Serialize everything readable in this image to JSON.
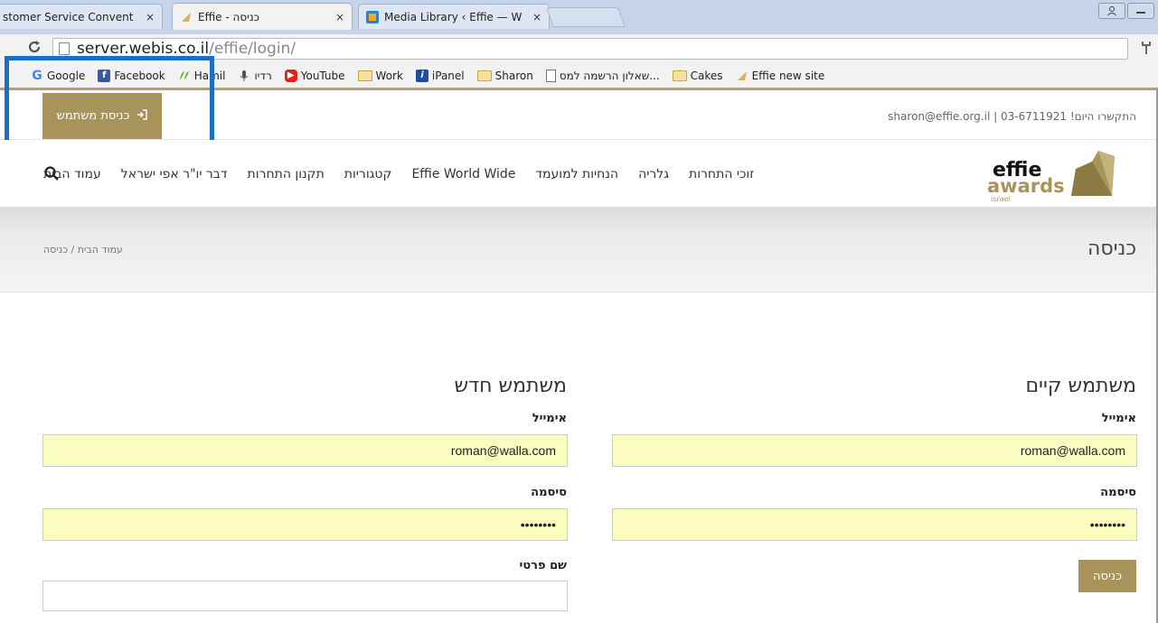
{
  "browser": {
    "tabs": [
      {
        "title": "stomer Service Convent",
        "favicon": "none",
        "active": false
      },
      {
        "title": "Effie - כניסה",
        "favicon": "effie-leaf",
        "active": true
      },
      {
        "title": "Media Library ‹ Effie — W",
        "favicon": "media-library",
        "active": false
      }
    ],
    "close_glyph": "×",
    "address": {
      "host": "server.webis.co.il",
      "path": "/effie/login/"
    },
    "bookmarks": [
      {
        "label": "Google",
        "icon": "google-icon",
        "color": "#4285f4"
      },
      {
        "label": "Facebook",
        "icon": "facebook-icon",
        "color": "#3b5998"
      },
      {
        "label": "Hamil",
        "icon": "hamil-icon",
        "color": "#6ab023"
      },
      {
        "label": "רדיו",
        "icon": "radio-icon",
        "color": "#555555"
      },
      {
        "label": "YouTube",
        "icon": "youtube-icon",
        "color": "#e62117"
      },
      {
        "label": "Work",
        "icon": "folder-icon",
        "color": "#f7e1a0"
      },
      {
        "label": "iPanel",
        "icon": "ipanel-icon",
        "color": "#1b4f9c"
      },
      {
        "label": "Sharon",
        "icon": "folder-icon",
        "color": "#f7e1a0"
      },
      {
        "label": "שאלון הרשמה למס...",
        "icon": "document-icon",
        "color": "#ffffff"
      },
      {
        "label": "Cakes",
        "icon": "folder-icon",
        "color": "#f7e1a0"
      },
      {
        "label": "Effie new site",
        "icon": "effie-leaf-icon",
        "color": "#c9a94d"
      }
    ]
  },
  "topbar": {
    "login_label": "כניסת משתמש",
    "contact": "התקשרו היום! 03-6711921 | sharon@effie.org.il"
  },
  "nav": {
    "items": [
      "עמוד הבית",
      "דבר יו\"ר אפי ישראל",
      "תקנון התחרות",
      "קטגוריות",
      "Effie World Wide",
      "הנחיות למועמד",
      "גלריה",
      "זוכי התחרות"
    ]
  },
  "logo": {
    "line1": "effie",
    "line2": "awards",
    "line3": "israel"
  },
  "page": {
    "title": "כניסה",
    "breadcrumb": "עמוד הבית / כניסה"
  },
  "existing_user": {
    "title": "משתמש קיים",
    "email_label": "אימייל",
    "email_value": "roman@walla.com",
    "password_label": "סיסמה",
    "password_value": "••••••••",
    "submit_label": "כניסה"
  },
  "new_user": {
    "title": "משתמש חדש",
    "email_label": "אימייל",
    "email_value": "roman@walla.com",
    "password_label": "סיסמה",
    "password_value": "••••••••",
    "first_name_label": "שם פרטי",
    "first_name_value": ""
  },
  "colors": {
    "brand_gold": "#a8945a",
    "autofill_yellow": "#fafcc0",
    "annotation_blue": "#1a6fc1"
  }
}
